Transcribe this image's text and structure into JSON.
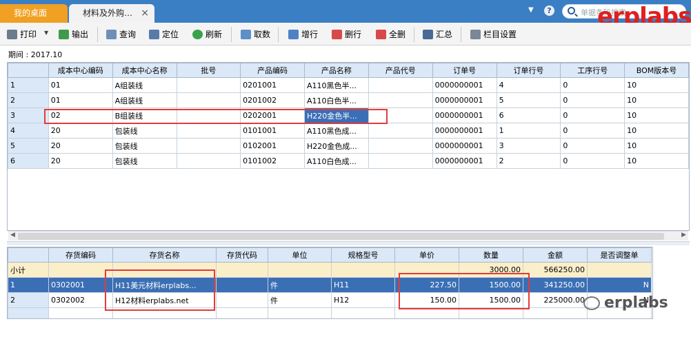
{
  "tabs": {
    "home": "我的桌面",
    "active": "材料及外购…",
    "close": "×"
  },
  "header": {
    "help": "?",
    "search_placeholder": "单据条码搜索",
    "brand": "erplabs"
  },
  "toolbar": {
    "print": "打印",
    "export": "输出",
    "query": "查询",
    "locate": "定位",
    "refresh": "刷新",
    "fetch": "取数",
    "add_row": "增行",
    "delete_row": "删行",
    "delete_all": "全删",
    "summary": "汇总",
    "column_settings": "栏目设置"
  },
  "period": "期间 : 2017.10",
  "upper_grid": {
    "headers": [
      "成本中心编码",
      "成本中心名称",
      "批号",
      "产品编码",
      "产品名称",
      "产品代号",
      "订单号",
      "订单行号",
      "工序行号",
      "BOM版本号"
    ],
    "rows": [
      {
        "n": "1",
        "c": [
          "01",
          "A组装线",
          "",
          "0201001",
          "A110黑色半...",
          "",
          "0000000001",
          "4",
          "0",
          "10"
        ]
      },
      {
        "n": "2",
        "c": [
          "01",
          "A组装线",
          "",
          "0201002",
          "A110白色半...",
          "",
          "0000000001",
          "5",
          "0",
          "10"
        ]
      },
      {
        "n": "3",
        "c": [
          "02",
          "B组装线",
          "",
          "0202001",
          "H220金色半...",
          "",
          "0000000001",
          "6",
          "0",
          "10"
        ]
      },
      {
        "n": "4",
        "c": [
          "20",
          "包装线",
          "",
          "0101001",
          "A110黑色成...",
          "",
          "0000000001",
          "1",
          "0",
          "10"
        ]
      },
      {
        "n": "5",
        "c": [
          "20",
          "包装线",
          "",
          "0102001",
          "H220金色成...",
          "",
          "0000000001",
          "3",
          "0",
          "10"
        ]
      },
      {
        "n": "6",
        "c": [
          "20",
          "包装线",
          "",
          "0101002",
          "A110白色成...",
          "",
          "0000000001",
          "2",
          "0",
          "10"
        ]
      }
    ]
  },
  "lower_grid": {
    "headers": [
      "存货编码",
      "存货名称",
      "存货代码",
      "单位",
      "规格型号",
      "单价",
      "数量",
      "金额",
      "是否调整单"
    ],
    "subtotal": {
      "label": "小计",
      "qty": "3000.00",
      "amount": "566250.00"
    },
    "rows": [
      {
        "n": "1",
        "code": "0302001",
        "name": "H11美元材料erplabs...",
        "alias": "",
        "unit": "件",
        "spec": "H11",
        "price": "227.50",
        "qty": "1500.00",
        "amount": "341250.00",
        "adj": "N"
      },
      {
        "n": "2",
        "code": "0302002",
        "name": "H12材料erplabs.net",
        "alias": "",
        "unit": "件",
        "spec": "H12",
        "price": "150.00",
        "qty": "1500.00",
        "amount": "225000.00",
        "adj": "N"
      }
    ]
  },
  "watermark": "erplabs"
}
